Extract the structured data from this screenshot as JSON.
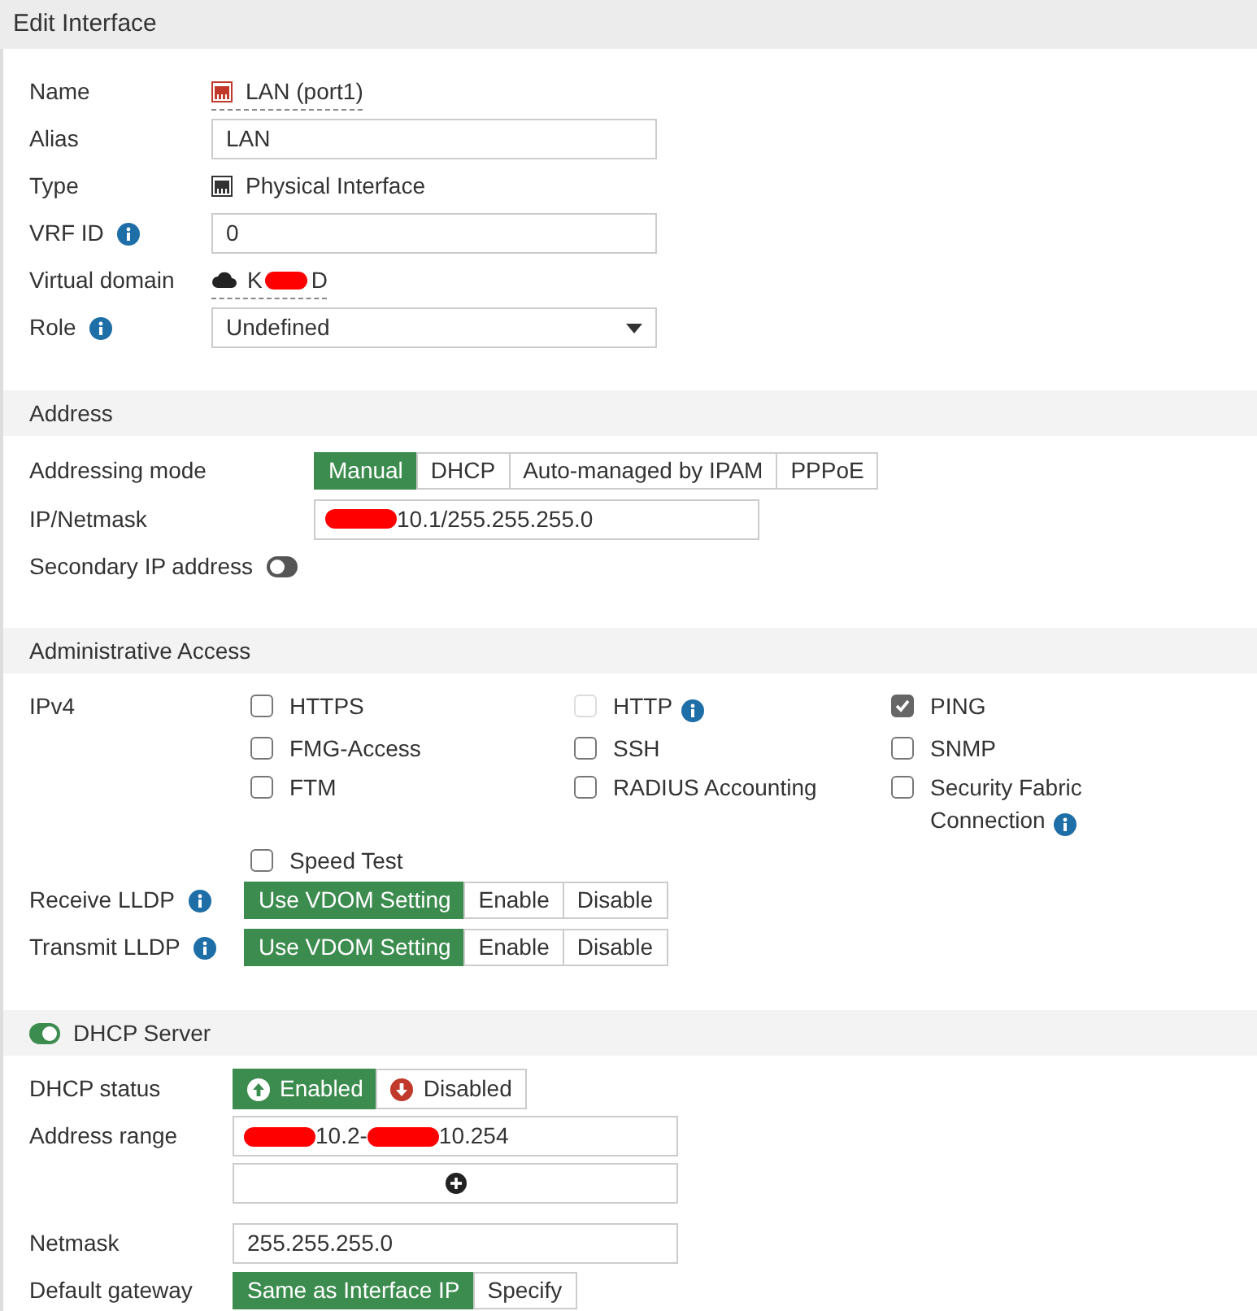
{
  "window": {
    "title": "Edit Interface"
  },
  "general": [
    {
      "kind": "link",
      "label": "Name",
      "text": "LAN (port1)"
    },
    {
      "kind": "input",
      "label": "Alias",
      "value": "LAN"
    },
    {
      "kind": "plain",
      "label": "Type",
      "text": "Physical Interface"
    },
    {
      "kind": "input",
      "label": "VRF ID",
      "info": true,
      "value": "0"
    },
    {
      "kind": "vdom",
      "label": "Virtual domain",
      "segments": [
        {
          "kind": "text",
          "text": "K"
        },
        {
          "kind": "redacted"
        },
        {
          "kind": "text",
          "text": "D"
        }
      ]
    },
    {
      "kind": "select",
      "label": "Role",
      "info": true,
      "value": "Undefined"
    }
  ],
  "address": {
    "title": "Address",
    "addressing_mode": {
      "label": "Addressing mode",
      "options": [
        {
          "label": "Manual",
          "selected": true
        },
        {
          "label": "DHCP",
          "selected": false
        },
        {
          "label": "Auto-managed by IPAM",
          "selected": false
        },
        {
          "label": "PPPoE",
          "selected": false
        }
      ]
    },
    "ip_netmask": {
      "label": "IP/Netmask",
      "segments": [
        {
          "kind": "redacted"
        },
        {
          "kind": "text",
          "text": "10.1/255.255.255.0"
        }
      ]
    },
    "secondary_ip": {
      "label": "Secondary IP address",
      "on": false
    }
  },
  "admin_access": {
    "title": "Administrative Access",
    "ipv4_label": "IPv4",
    "services": [
      {
        "label": "HTTPS",
        "checked": false,
        "disabled": false,
        "info": false
      },
      {
        "label": "HTTP",
        "checked": false,
        "disabled": true,
        "info": true
      },
      {
        "label": "PING",
        "checked": true,
        "disabled": false,
        "info": false
      },
      {
        "label": "FMG-Access",
        "checked": false,
        "disabled": false,
        "info": false
      },
      {
        "label": "SSH",
        "checked": false,
        "disabled": false,
        "info": false
      },
      {
        "label": "SNMP",
        "checked": false,
        "disabled": false,
        "info": false
      },
      {
        "label": "FTM",
        "checked": false,
        "disabled": false,
        "info": false
      },
      {
        "label": "RADIUS Accounting",
        "checked": false,
        "disabled": false,
        "info": false
      },
      {
        "label": "Security Fabric Connection",
        "checked": false,
        "disabled": false,
        "info": true
      },
      {
        "label": "Speed Test",
        "checked": false,
        "disabled": false,
        "info": false
      }
    ],
    "lldp": [
      {
        "label": "Receive LLDP",
        "options": [
          {
            "label": "Use VDOM Setting",
            "selected": true
          },
          {
            "label": "Enable",
            "selected": false
          },
          {
            "label": "Disable",
            "selected": false
          }
        ]
      },
      {
        "label": "Transmit LLDP",
        "options": [
          {
            "label": "Use VDOM Setting",
            "selected": true
          },
          {
            "label": "Enable",
            "selected": false
          },
          {
            "label": "Disable",
            "selected": false
          }
        ]
      }
    ]
  },
  "dhcp_server": {
    "title": "DHCP Server",
    "on": true,
    "status": {
      "label": "DHCP status",
      "options": [
        {
          "label": "Enabled",
          "kind": "up",
          "selected": true
        },
        {
          "label": "Disabled",
          "kind": "down",
          "selected": false
        }
      ]
    },
    "address_range": {
      "label": "Address range",
      "segments": [
        {
          "kind": "redacted"
        },
        {
          "kind": "text",
          "text": "10.2-"
        },
        {
          "kind": "redacted"
        },
        {
          "kind": "text",
          "text": "10.254"
        }
      ]
    },
    "netmask": {
      "label": "Netmask",
      "value": "255.255.255.0"
    },
    "default_gateway": {
      "label": "Default gateway",
      "options": [
        {
          "label": "Same as Interface IP",
          "selected": true
        },
        {
          "label": "Specify",
          "selected": false
        }
      ]
    }
  }
}
